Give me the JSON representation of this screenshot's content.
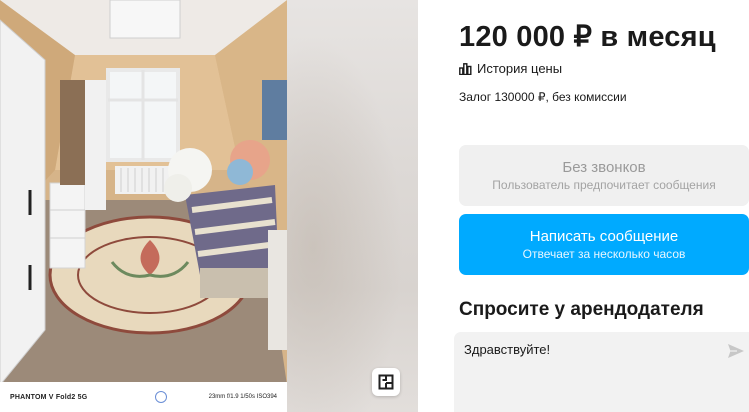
{
  "gallery": {
    "camera_model": "PHANTOM V Fold2 5G",
    "camera_settings": "23mm f/1.9 1/50s ISO394",
    "map_icon": "floorplan-icon"
  },
  "listing": {
    "price": "120 000 ₽ в месяц",
    "price_history_label": "История цены",
    "price_history_icon": "bar-chart-icon",
    "deposit": "Залог 130000 ₽, без комиссии"
  },
  "actions": {
    "no_calls_title": "Без звонков",
    "no_calls_subtitle": "Пользователь предпочитает сообщения",
    "message_title": "Написать сообщение",
    "message_subtitle": "Отвечает за несколько часов",
    "message_color": "#00aaff"
  },
  "ask": {
    "title": "Спросите у арендодателя",
    "input_value": "Здравствуйте!",
    "send_icon": "send-icon"
  }
}
